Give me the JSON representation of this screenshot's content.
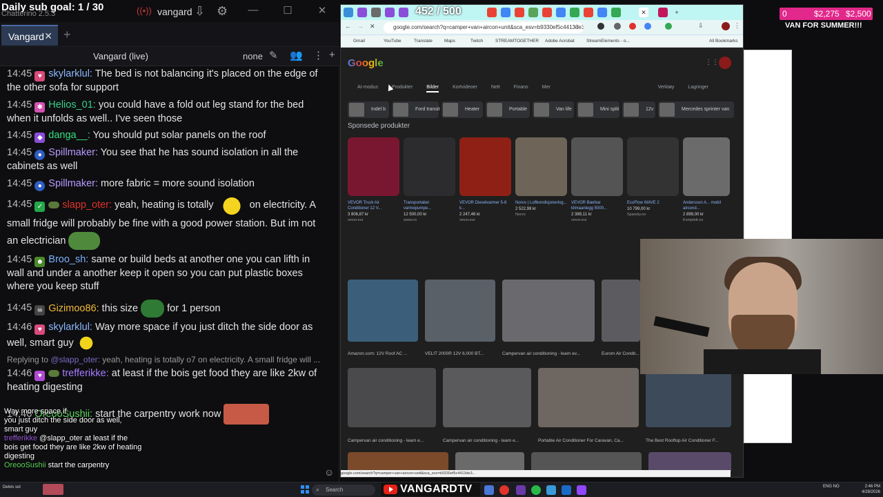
{
  "chat_app": {
    "sub_goal": "Daily sub goal: 1 / 30",
    "app_version": "Chatterino 2.5.3",
    "live_user": "vangard",
    "tab": "Vangard",
    "split_title": "Vangard (live)",
    "split_mode": "none",
    "messages": [
      {
        "time": "14:45",
        "user": "skylarklul:",
        "color": "#8bb8ff",
        "badge": "#d84a7a",
        "text": "The bed is not balancing it's placed on the edge of the other sofa for support"
      },
      {
        "time": "14:45",
        "user": "Helios_01:",
        "color": "#39d08b",
        "badge": "#d052b0",
        "text": "you could have a fold out leg stand for the bed when it unfolds as well.. I've seen those"
      },
      {
        "time": "14:45",
        "user": "danga__:",
        "color": "#33e07f",
        "badge": "#8a4ed9",
        "text": "You should put solar panels on the roof"
      },
      {
        "time": "14:45",
        "user": "Spillmaker:",
        "color": "#b59bff",
        "badge": "#2f5fc4",
        "text": "You see that he has sound isolation in all the cabinets as well"
      },
      {
        "time": "14:45",
        "user": "Spillmaker:",
        "color": "#b59bff",
        "badge": "#2f5fc4",
        "text": "more fabric = more sound isolation"
      },
      {
        "time": "14:45",
        "user": "slapp_oter:",
        "color": "#e0322a",
        "badge": "#24a84a",
        "text": "yeah, heating is totally",
        "text2": "on electricity. A small fridge will probably be fine with a good power station. But im not an electrician"
      },
      {
        "time": "14:45",
        "user": "Broo_sh:",
        "color": "#7ab0ff",
        "badge": "#4a8a2a",
        "text": "same or build beds at another one you can lifth in wall and under a another keep it open so you can put plastic boxes where you keep stuff"
      },
      {
        "time": "14:45",
        "user": "Gizimoo86:",
        "color": "#f2b93b",
        "badge": "#444",
        "text": "this size",
        "text2": "for 1 person"
      },
      {
        "time": "14:46",
        "user": "skylarklul:",
        "color": "#8bb8ff",
        "badge": "#d84a7a",
        "text": "Way more space if you just ditch the side door as well, smart guy"
      }
    ],
    "reply_to": {
      "label": "Replying to",
      "user": "@slapp_oter:",
      "text": "yeah, heating is totally o7 on electricity. A small fridge will ..."
    },
    "reply_msg": {
      "time": "14:46",
      "user": "trefferikke:",
      "color": "#a47cff",
      "badge": "#b04ad4",
      "text": "at least if the bois get food they are like 2kw of heating digesting"
    },
    "last_msg": {
      "time": "14:46",
      "user": "OreooSushii:",
      "color": "#5ad65a",
      "text": "start the carpentry work now"
    },
    "overlay_lines": [
      {
        "user": "",
        "text": "Way more space if"
      },
      {
        "user": "",
        "text": "you just ditch the side door as well,"
      },
      {
        "user": "",
        "text": "smart guy"
      },
      {
        "user": "trefferikke",
        "text": "@slapp_oter at least if the bois get food they are like 2kw of heating digesting"
      },
      {
        "user": "OreooSushii",
        "text": "start the carpentry"
      }
    ]
  },
  "browser": {
    "counter": "452 / 500",
    "url": "google.com/search?q=camper+van+aircon+unit&sca_esv=b9330ef5c4413de3...",
    "bookmarks": [
      "Gmail",
      "YouTube",
      "Translate",
      "Maps",
      "Twitch",
      "STREAMTOGETHER",
      "Adobe Acrobat",
      "StreamElements - o...",
      "All Bookmarks"
    ],
    "logo": "Google",
    "filters": [
      "AI-modus",
      "Produkter",
      "Bilder",
      "Kortvideoer",
      "Nett",
      "Finans",
      "Mer",
      "Verktøy",
      "Lagringer"
    ],
    "chips": [
      "Indel b",
      "Ford transit",
      "Heater",
      "Portable",
      "Van life",
      "Mini split",
      "12v",
      "Mercedes sprinter van"
    ],
    "sponsored": "Sponsede produkter",
    "products": [
      {
        "title": "VEVOR Truck Air Conditioner 12 V...",
        "price": "3 806,87 kr",
        "shop": "vevor.eur"
      },
      {
        "title": "Transportabel varmepumpe...",
        "price": "12 500,00 kr",
        "shop": "www.no"
      },
      {
        "title": "VEVOR Dieselvarmer 5-8 k...",
        "price": "2 247,46 kr",
        "shop": "vevor.eur"
      },
      {
        "title": "Norvo | Luftkondisjonering...",
        "price": "2 522,99 kr",
        "shop": "Norvo"
      },
      {
        "title": "VEVOR Bærbar klimaanlegg 5000...",
        "price": "2 389,11 kr",
        "shop": "vevor.eur"
      },
      {
        "title": "EcoFlow WAVE 2",
        "price": "10 799,00 kr",
        "shop": "Spareky.no"
      },
      {
        "title": "Andersson A... mobil aircond...",
        "price": "2 899,00 kr",
        "shop": "Komplett.no"
      }
    ],
    "image_results": [
      "Amazon.com: 12V Roof AC ...",
      "VELIT 2000R 12V 6,000 BT...",
      "Campervan air conditioning - learn ev...",
      "Eurom Air Condit...",
      "Campervan air conditioning - learn e...",
      "Campervan air conditioning - learn e...",
      "Portable Air Conditioner For Caravan, Ca...",
      "The Best Rooftop Air Conditioner F..."
    ]
  },
  "overlay": {
    "goal_current": "0",
    "goal_mid": "$2,275",
    "goal_target": "$2,500",
    "goal_caption": "VAN FOR SUMMER!!!"
  },
  "taskbar": {
    "search": "Search",
    "brand": "VANGARDTV",
    "lang": "ENG NO",
    "time": "2:46 PM",
    "date": "4/28/2026",
    "weather": "Delvis sol"
  }
}
